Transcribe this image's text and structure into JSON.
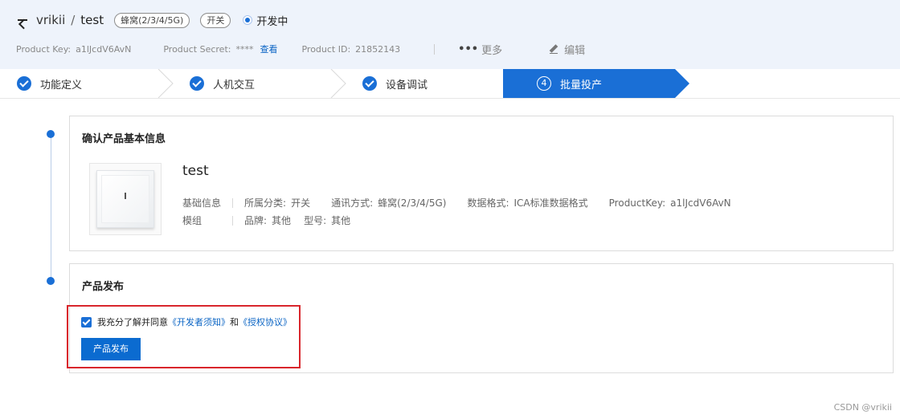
{
  "header": {
    "back_icon": "arrow-left-icon",
    "breadcrumb_parent": "vrikii",
    "breadcrumb_separator": "/",
    "product_name": "test",
    "tags": [
      "蜂窝(2/3/4/5G)",
      "开关"
    ],
    "status": "开发中",
    "meta": {
      "product_key_label": "Product Key:",
      "product_key_value": "a1lJcdV6AvN",
      "product_secret_label": "Product Secret:",
      "product_secret_value": "****",
      "product_secret_link": "查看",
      "product_id_label": "Product ID:",
      "product_id_value": "21852143",
      "more_label": "更多",
      "more_icon": "•••",
      "edit_label": "编辑"
    }
  },
  "steps": [
    {
      "label": "功能定义",
      "state": "done"
    },
    {
      "label": "人机交互",
      "state": "done"
    },
    {
      "label": "设备调试",
      "state": "done"
    },
    {
      "label": "批量投产",
      "state": "active",
      "number": "4"
    }
  ],
  "basic_info_card": {
    "title": "确认产品基本信息",
    "product_name": "test",
    "row1_label": "基础信息",
    "row1_items": [
      {
        "key": "所属分类:",
        "value": "开关"
      },
      {
        "key": "通讯方式:",
        "value": "蜂窝(2/3/4/5G)"
      },
      {
        "key": "数据格式:",
        "value": "ICA标准数据格式"
      },
      {
        "key": "ProductKey:",
        "value": "a1lJcdV6AvN"
      }
    ],
    "row2_label": "模组",
    "row2_items": [
      {
        "key": "品牌:",
        "value": "其他"
      },
      {
        "key": "型号:",
        "value": "其他"
      }
    ]
  },
  "publish_card": {
    "title": "产品发布",
    "agree_prefix": "我充分了解并同意",
    "agree_link1": "《开发者须知》",
    "agree_middle": "和",
    "agree_link2": "《授权协议》",
    "agree_checked": true,
    "publish_button": "产品发布"
  },
  "colors": {
    "accent": "#1a6fd6",
    "header_bg": "#eef3fb",
    "highlight": "#d9262c"
  },
  "watermark": "CSDN @vrikii"
}
